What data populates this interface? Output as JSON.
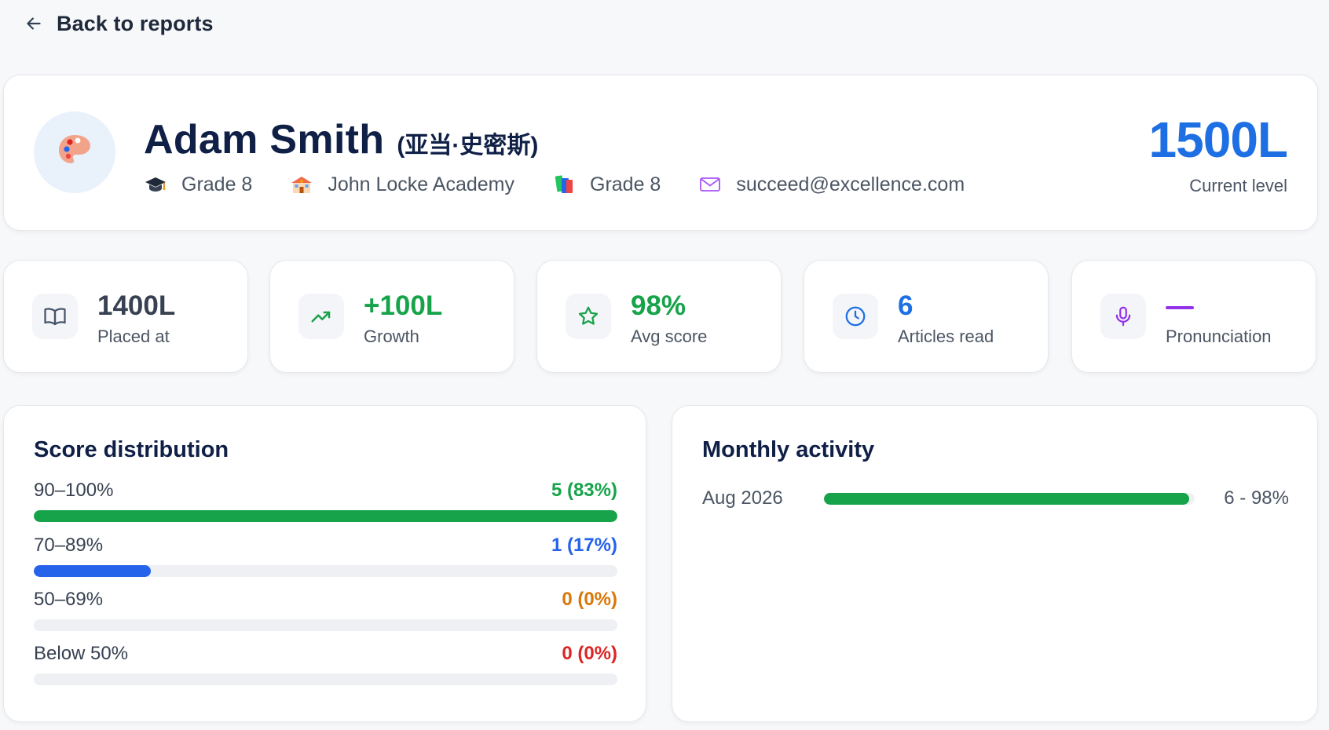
{
  "nav": {
    "back_label": "Back to reports"
  },
  "student": {
    "name": "Adam Smith",
    "alt_name": "(亚当·史密斯)",
    "meta": [
      {
        "icon": "graduation-cap-icon",
        "text": "Grade 8"
      },
      {
        "icon": "school-icon",
        "text": "John Locke Academy"
      },
      {
        "icon": "books-icon",
        "text": "Grade 8"
      },
      {
        "icon": "envelope-icon",
        "text": "succeed@excellence.com"
      }
    ],
    "level": {
      "value": "1500L",
      "caption": "Current level"
    }
  },
  "stats": [
    {
      "icon": "book-open-icon",
      "value": "1400L",
      "label": "Placed at",
      "color": "#374151"
    },
    {
      "icon": "trending-up-icon",
      "value": "+100L",
      "label": "Growth",
      "color": "#16a34a"
    },
    {
      "icon": "star-icon",
      "value": "98%",
      "label": "Avg score",
      "color": "#16a34a"
    },
    {
      "icon": "clock-icon",
      "value": "6",
      "label": "Articles read",
      "color": "#1d6fe3"
    },
    {
      "icon": "microphone-icon",
      "value": "—",
      "label": "Pronunciation",
      "color": "#9333ea"
    }
  ],
  "score_distribution": {
    "title": "Score distribution",
    "rows": [
      {
        "range": "90–100%",
        "count": "5 (83%)",
        "percent": 100,
        "color": "#16a34a"
      },
      {
        "range": "70–89%",
        "count": "1 (17%)",
        "percent": 20,
        "color": "#2563eb"
      },
      {
        "range": "50–69%",
        "count": "0 (0%)",
        "percent": 0,
        "color": "#d97706"
      },
      {
        "range": "Below 50%",
        "count": "0 (0%)",
        "percent": 0,
        "color": "#dc2626"
      }
    ]
  },
  "monthly_activity": {
    "title": "Monthly activity",
    "rows": [
      {
        "month": "Aug 2026",
        "result": "6 - 98%",
        "percent": 98.5,
        "color": "#16a34a"
      }
    ]
  }
}
